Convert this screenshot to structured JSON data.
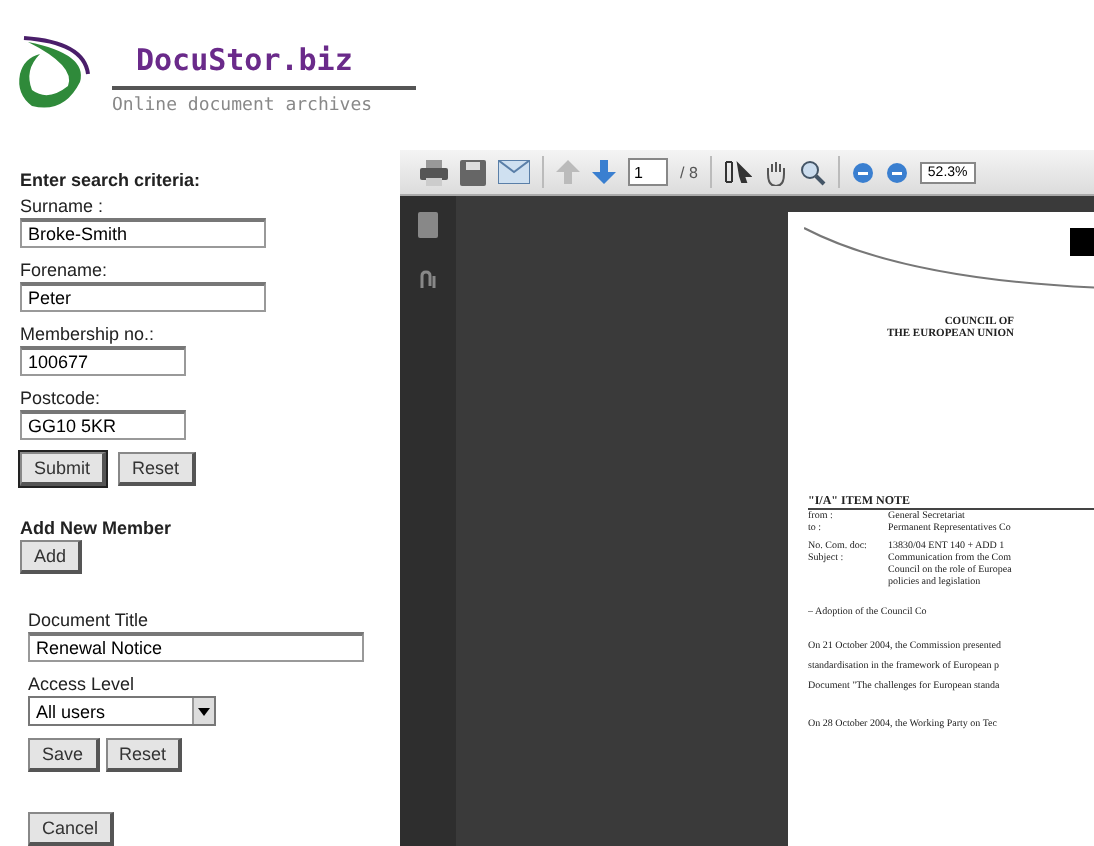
{
  "brand": {
    "name": "DocuStor.biz",
    "tagline": "Online document archives"
  },
  "search": {
    "heading": "Enter search criteria:",
    "fields": [
      {
        "label": "Surname :",
        "value": "Broke-Smith",
        "kind": "wide"
      },
      {
        "label": "Forename:",
        "value": "Peter",
        "kind": "wide"
      },
      {
        "label": "Membership no.:",
        "value": "100677",
        "kind": "narrow"
      },
      {
        "label": "Postcode:",
        "value": "GG10 5KR",
        "kind": "narrow"
      }
    ],
    "buttons": [
      {
        "label": "Submit",
        "kind": "primary"
      },
      {
        "label": "Reset",
        "kind": "plain"
      }
    ]
  },
  "add_member": {
    "heading": "Add New Member",
    "button": "Add"
  },
  "document": {
    "title_label": "Document Title",
    "title_value": "Renewal Notice",
    "access_label": "Access Level",
    "access_value": "All users",
    "buttons": [
      "Save",
      "Reset"
    ],
    "cancel": "Cancel"
  },
  "viewer": {
    "page": "1",
    "page_count": "/ 8",
    "zoom": "52.3%",
    "doc": {
      "header": [
        "COUNCIL OF",
        "THE EUROPEAN UNION"
      ],
      "note_title": "\"I/A\" ITEM NOTE",
      "meta": [
        {
          "label": "from :",
          "value": "General Secretariat"
        },
        {
          "label": "to :",
          "value": "Permanent Representatives Co"
        },
        {
          "label": "No. Com. doc:",
          "value": "13830/04 ENT 140 + ADD 1"
        },
        {
          "label": "Subject :",
          "value": "Communication from the Com"
        },
        {
          "value": "Council on the role of Europea"
        },
        {
          "value": "policies and legislation"
        }
      ],
      "item": "–  Adoption of the Council Co",
      "paragraphs": [
        "On 21 October 2004, the Commission presented",
        "standardisation in the framework of European p",
        "Document \"The challenges for European standa",
        "On 28 October 2004, the Working Party on Tec"
      ]
    }
  }
}
